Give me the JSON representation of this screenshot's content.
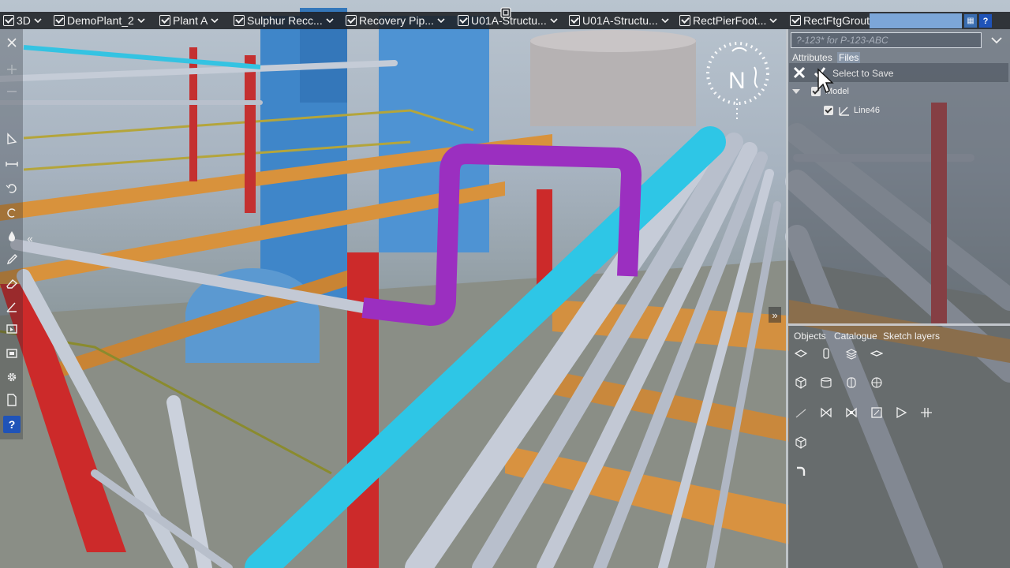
{
  "layer_tabs": [
    {
      "label": "3D",
      "checked": true
    },
    {
      "label": "DemoPlant_2",
      "checked": true
    },
    {
      "label": "Plant A",
      "checked": true
    },
    {
      "label": "Sulphur Recc...",
      "checked": true
    },
    {
      "label": "Recovery Pip...",
      "checked": true
    },
    {
      "label": "U01A-Structu...",
      "checked": true
    },
    {
      "label": "U01A-Structu...",
      "checked": true
    },
    {
      "label": "RectPierFoot...",
      "checked": true
    },
    {
      "label": "RectFtgGrout...",
      "checked": true
    }
  ],
  "tabbar": {
    "menu_icon": "list-icon",
    "help_label": "?"
  },
  "compass": {
    "letter": "N"
  },
  "left_toolbar": {
    "collapse_label": "«",
    "help_label": "?",
    "tools": [
      "close-icon",
      "add-icon",
      "minus-icon",
      "select-arrow-icon",
      "measure-icon",
      "undo-icon",
      "redo-icon",
      "fill-icon",
      "pencil-icon",
      "eraser-icon",
      "angle-icon",
      "screen-icon",
      "camera-icon",
      "settings-icon",
      "document-icon",
      "help-icon"
    ]
  },
  "viewport": {
    "expand_label": "»"
  },
  "right_panel": {
    "filter": {
      "placeholder": "?-123* for P-123-ABC",
      "value": ""
    },
    "tabs": [
      "Attributes",
      "Files"
    ],
    "active_tab": "Files",
    "files": {
      "select_to_save": "Select to Save",
      "tree": [
        {
          "label": "Model",
          "checked": true,
          "expanded": true,
          "children": [
            {
              "label": "Line46",
              "checked": true
            }
          ]
        }
      ]
    },
    "lower_tabs": [
      "Objects",
      "Catalogue",
      "Sketch layers"
    ],
    "object_tools": [
      "plane-icon",
      "cylinder-icon",
      "stack-icon",
      "disc-icon",
      "box-icon",
      "drum-icon",
      "tank-icon",
      "sphere-icon",
      "line-icon",
      "valve-icon",
      "valve-actuated-icon",
      "square-icon",
      "triangle-icon",
      "flange-icon",
      "cube-icon",
      "elbow-icon"
    ]
  },
  "colors": {
    "accent": "#1f53b8",
    "highlight_pipe": "#9b2fc0",
    "cyan_pipe": "#2ec6e6"
  }
}
